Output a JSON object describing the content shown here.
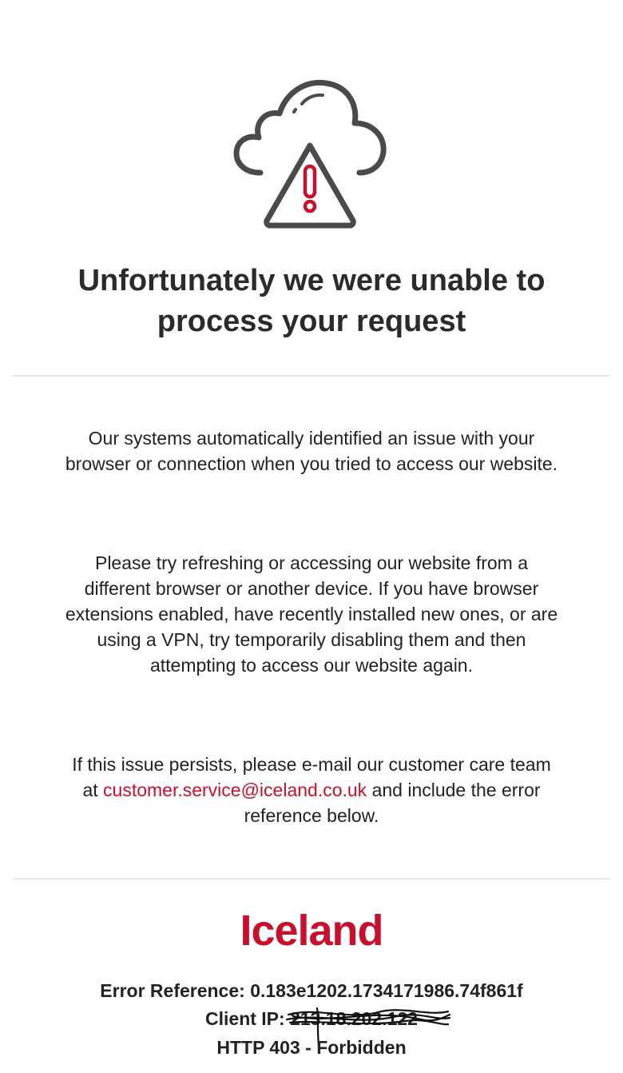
{
  "error_page": {
    "icon": "cloud-warning-icon",
    "title": "Unfortunately we were unable to process your request",
    "paragraph_1": "Our systems automatically identified an issue with your browser or connection when you tried to access our website.",
    "paragraph_2": "Please try refreshing or accessing our website from a different browser or another device. If you have browser extensions enabled, have recently installed new ones, or are using a VPN, try temporarily disabling them and then attempting to access our website again.",
    "paragraph_3_before": "If this issue persists, please e-mail our customer care team at ",
    "email": "customer.service@iceland.co.uk",
    "paragraph_3_after": " and include the error reference below."
  },
  "footer": {
    "logo_text": "Iceland",
    "error_reference_label": "Error Reference: ",
    "error_reference_value": "0.183e1202.1734171986.74f861f",
    "client_ip_label": "Client IP: ",
    "client_ip_value": "213.18.202.122",
    "http_status": "HTTP 403 - Forbidden"
  },
  "colors": {
    "accent": "#c8102e",
    "icon_stroke": "#4a4a4a",
    "text": "#222222",
    "divider": "#e6e6e6"
  }
}
